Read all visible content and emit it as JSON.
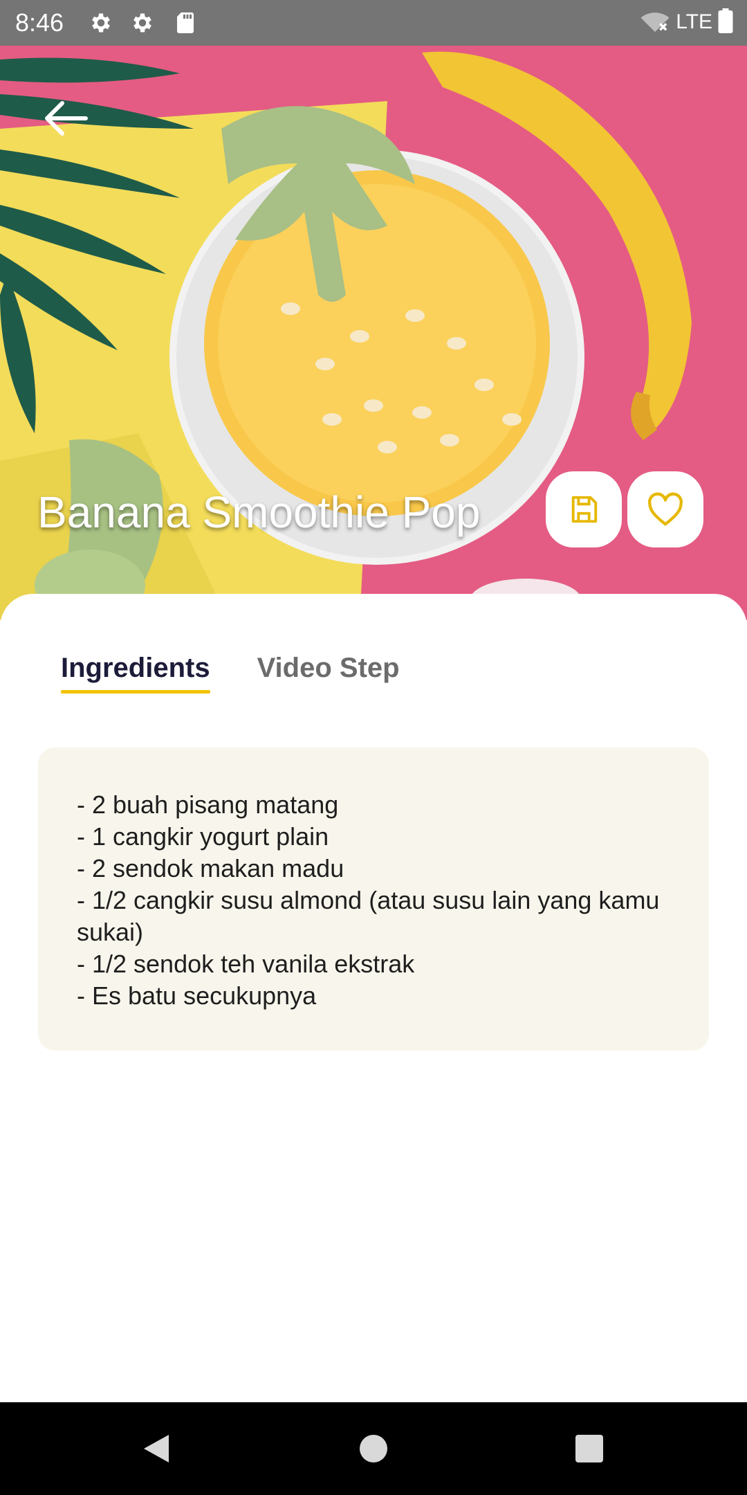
{
  "status_bar": {
    "time": "8:46",
    "network": "LTE",
    "icons": [
      "settings-icon",
      "settings-icon",
      "sd-card-icon",
      "wifi-off-icon",
      "signal-icon",
      "battery-icon"
    ]
  },
  "recipe": {
    "title": "Banana Smoothie Pop"
  },
  "actions": {
    "back_icon": "arrow-left-icon",
    "save_icon": "save-icon",
    "favorite_icon": "heart-icon"
  },
  "tabs": [
    {
      "label": "Ingredients",
      "active": true
    },
    {
      "label": "Video Step",
      "active": false
    }
  ],
  "ingredients": [
    "- 2 buah pisang matang",
    "- 1 cangkir yogurt plain",
    "- 2 sendok makan madu",
    "- 1/2 cangkir susu almond (atau susu lain yang kamu sukai)",
    "- 1/2 sendok teh vanila ekstrak",
    "- Es batu secukupnya"
  ],
  "colors": {
    "accent": "#f2c200",
    "status_bar": "#757575",
    "card_background": "#f8f6ec"
  },
  "nav_bar": {
    "buttons": [
      "back-nav-icon",
      "home-nav-icon",
      "recents-nav-icon"
    ]
  }
}
